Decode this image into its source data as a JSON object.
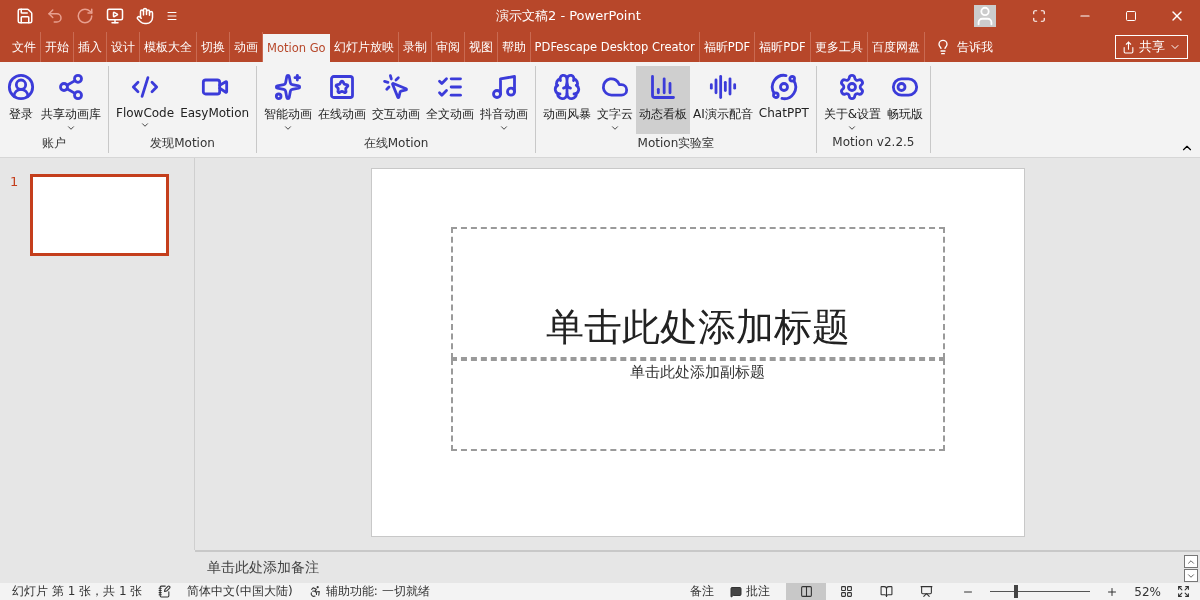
{
  "window": {
    "title": "演示文稿2  -  PowerPoint"
  },
  "tabs": [
    {
      "label": "文件",
      "selected": false
    },
    {
      "label": "开始",
      "selected": false
    },
    {
      "label": "插入",
      "selected": false
    },
    {
      "label": "设计",
      "selected": false
    },
    {
      "label": "模板大全",
      "selected": false
    },
    {
      "label": "切换",
      "selected": false
    },
    {
      "label": "动画",
      "selected": false
    },
    {
      "label": "Motion Go",
      "selected": true
    },
    {
      "label": "幻灯片放映",
      "selected": false
    },
    {
      "label": "录制",
      "selected": false
    },
    {
      "label": "审阅",
      "selected": false
    },
    {
      "label": "视图",
      "selected": false
    },
    {
      "label": "帮助",
      "selected": false
    },
    {
      "label": "PDFescape Desktop Creator",
      "selected": false
    },
    {
      "label": "福昕PDF",
      "selected": false
    },
    {
      "label": "福昕PDF",
      "selected": false
    },
    {
      "label": "更多工具",
      "selected": false
    },
    {
      "label": "百度网盘",
      "selected": false
    }
  ],
  "tell_me": "告诉我",
  "share_button": "共享",
  "ribbon_groups": [
    {
      "label": "账户",
      "buttons": [
        {
          "label": "登录",
          "dropdown": false,
          "selected": false
        },
        {
          "label": "共享动画库",
          "dropdown": true,
          "selected": false
        }
      ]
    },
    {
      "label": "发现Motion",
      "buttons": [
        {
          "label": "FlowCode",
          "dropdown": true,
          "selected": false
        },
        {
          "label": "EasyMotion",
          "dropdown": false,
          "selected": false
        }
      ]
    },
    {
      "label": "在线Motion",
      "buttons": [
        {
          "label": "智能动画",
          "dropdown": true,
          "selected": false
        },
        {
          "label": "在线动画",
          "dropdown": false,
          "selected": false
        },
        {
          "label": "交互动画",
          "dropdown": false,
          "selected": false
        },
        {
          "label": "全文动画",
          "dropdown": false,
          "selected": false
        },
        {
          "label": "抖音动画",
          "dropdown": true,
          "selected": false
        }
      ]
    },
    {
      "label": "Motion实验室",
      "buttons": [
        {
          "label": "动画风暴",
          "dropdown": false,
          "selected": false
        },
        {
          "label": "文字云",
          "dropdown": true,
          "selected": false
        },
        {
          "label": "动态看板",
          "dropdown": false,
          "selected": true
        },
        {
          "label": "AI演示配音",
          "dropdown": false,
          "selected": false
        },
        {
          "label": "ChatPPT",
          "dropdown": false,
          "selected": false
        }
      ]
    },
    {
      "label": "Motion v2.2.5",
      "buttons": [
        {
          "label": "关于&设置",
          "dropdown": true,
          "selected": false
        },
        {
          "label": "畅玩版",
          "dropdown": false,
          "selected": false
        }
      ]
    }
  ],
  "thumbnails": [
    {
      "number": "1",
      "selected": true
    }
  ],
  "slide": {
    "title_placeholder": "单击此处添加标题",
    "subtitle_placeholder": "单击此处添加副标题"
  },
  "notes": {
    "placeholder": "单击此处添加备注"
  },
  "status_bar": {
    "slide_info": "幻灯片 第 1 张，共 1 张",
    "language": "简体中文(中国大陆)",
    "accessibility": "辅助功能: 一切就绪",
    "notes_button": "备注",
    "comments_button": "批注",
    "views": [
      {
        "selected": true
      },
      {
        "selected": false
      },
      {
        "selected": false
      },
      {
        "selected": false
      }
    ],
    "zoom": {
      "level": 0.24,
      "reading": "52%"
    }
  }
}
